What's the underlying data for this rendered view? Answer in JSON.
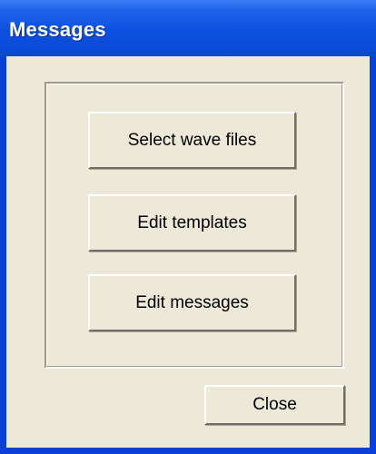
{
  "window": {
    "title": "Messages"
  },
  "buttons": {
    "select_wave_files": "Select wave files",
    "edit_templates": "Edit templates",
    "edit_messages": "Edit messages",
    "close": "Close"
  },
  "colors": {
    "titlebar": "#0a47d6",
    "dialog_background": "#ece9d8",
    "title_text": "#ffffff"
  }
}
